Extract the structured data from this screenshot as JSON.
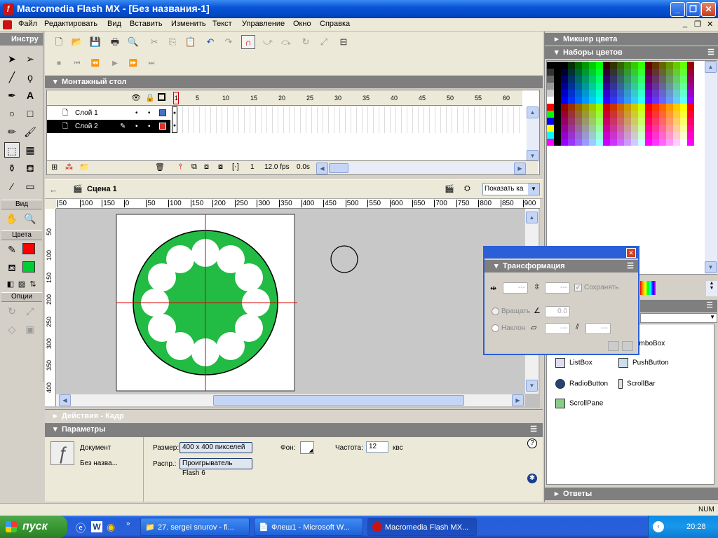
{
  "window": {
    "title": "Macromedia Flash MX - [Без названия-1]"
  },
  "menu": [
    "Файл",
    "Редактировать",
    "Вид",
    "Вставить",
    "Изменить",
    "Текст",
    "Управление",
    "Окно",
    "Справка"
  ],
  "tools": {
    "title": "Инстру",
    "view_label": "Вид",
    "colors_label": "Цвета",
    "options_label": "Опции"
  },
  "timeline": {
    "title": "Монтажный стол",
    "frame_ticks": [
      "1",
      "5",
      "10",
      "15",
      "20",
      "25",
      "30",
      "35",
      "40",
      "45",
      "50",
      "55",
      "60"
    ],
    "layers": [
      {
        "name": "Слой 1",
        "color": "#4472c4"
      },
      {
        "name": "Слой 2",
        "color": "#e03030"
      }
    ],
    "current_frame": "1",
    "fps": "12.0 fps",
    "time": "0.0s"
  },
  "scene": {
    "name": "Сцена 1",
    "zoom": "Показать ка"
  },
  "ruler_h": [
    "50",
    "100",
    "150",
    "0",
    "50",
    "100",
    "150",
    "200",
    "250",
    "300",
    "350",
    "400",
    "450",
    "500",
    "550",
    "600",
    "650",
    "700",
    "750",
    "800",
    "850",
    "900"
  ],
  "ruler_v": [
    "50",
    "100",
    "150",
    "200",
    "250",
    "300",
    "350",
    "400"
  ],
  "actions": {
    "title": "Действия - Кадр"
  },
  "params": {
    "title": "Параметры",
    "doc_label": "Документ",
    "doc_name": "Без назва...",
    "size_label": "Размер:",
    "size_value": "400 x 400 пикселей",
    "bg_label": "Фон:",
    "fps_label": "Частота:",
    "fps_value": "12",
    "fps_unit": "квс",
    "publish_label": "Распр.:",
    "publish_value": "Проигрыватель Flash 6"
  },
  "right": {
    "mixer": "Микшер цвета",
    "swatches": "Наборы цветов",
    "answers": "Ответы",
    "components": [
      "ComboBox",
      "ListBox",
      "PushButton",
      "RadioButton",
      "ScrollBar",
      "ScrollPane"
    ],
    "combo_partial": "omboBox"
  },
  "transform": {
    "title": "Трансформация",
    "width_value": "---",
    "height_value": "---",
    "keep": "Сохранять",
    "rotate": "Вращать",
    "rotate_value": "0.0",
    "skew": "Наклон",
    "skew_h": "---",
    "skew_v": "---"
  },
  "status": {
    "num": "NUM"
  },
  "taskbar": {
    "start": "пуск",
    "items": [
      "27. sergei snurov - fi...",
      "Флеш1 - Microsoft W...",
      "Macromedia Flash MX..."
    ],
    "lang": "RU",
    "clock": "20:28"
  },
  "colors": {
    "stroke": "#ff0000",
    "fill": "#00cc33",
    "circle_green": "#22bb44",
    "accent": "#0a54d8"
  }
}
